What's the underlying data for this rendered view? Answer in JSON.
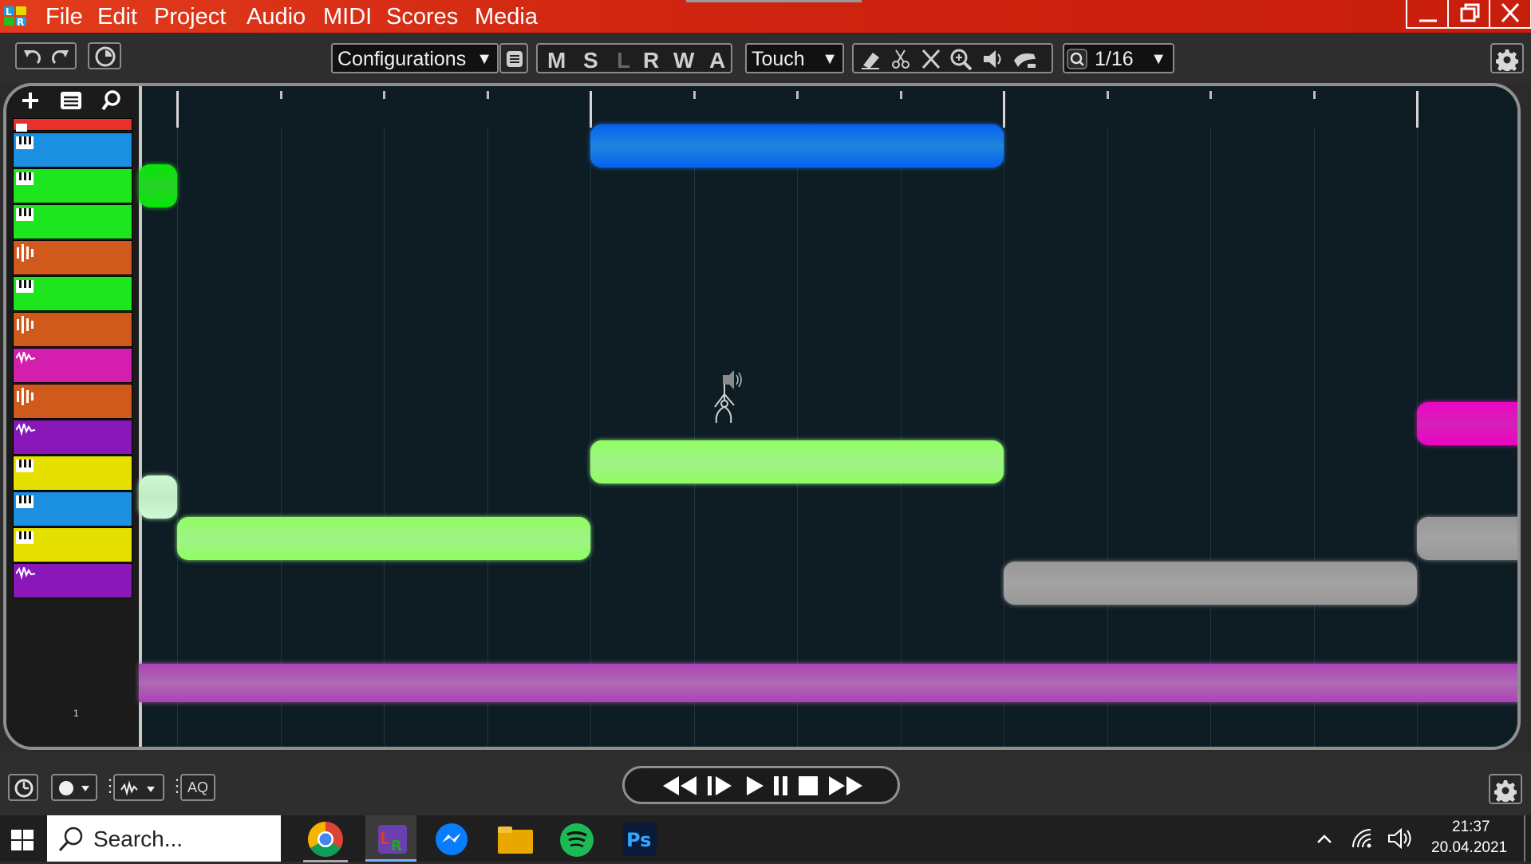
{
  "titlebar": {
    "menu": [
      "File",
      "Edit",
      "Project",
      "Audio",
      "MIDI",
      "Scores",
      "Media"
    ],
    "app_icon": "app-logo-icon",
    "color": "#d42812"
  },
  "toolbar": {
    "configurations_label": "Configurations",
    "mode_letters": [
      "M",
      "S",
      "L",
      "R",
      "W",
      "A"
    ],
    "automation_mode": "Touch",
    "quantize_value": "1/16"
  },
  "track_list": {
    "footer_number": "1",
    "tracks": [
      {
        "type": "folder",
        "color": "#e8312a"
      },
      {
        "type": "midi",
        "color": "#1b8fe0"
      },
      {
        "type": "midi",
        "color": "#1ee61e"
      },
      {
        "type": "midi",
        "color": "#1ee61e"
      },
      {
        "type": "audio",
        "color": "#cf5a1c"
      },
      {
        "type": "midi",
        "color": "#1ee61e"
      },
      {
        "type": "audio",
        "color": "#cf5a1c"
      },
      {
        "type": "wave",
        "color": "#d41fae"
      },
      {
        "type": "audio",
        "color": "#cf5a1c"
      },
      {
        "type": "wave",
        "color": "#8a18b8"
      },
      {
        "type": "midi",
        "color": "#e6e000"
      },
      {
        "type": "midi",
        "color": "#1b8fe0"
      },
      {
        "type": "midi",
        "color": "#e6e000"
      },
      {
        "type": "wave",
        "color": "#8a18b8"
      }
    ]
  },
  "clips": [
    {
      "track": 1,
      "color": "#1a6fd6"
    },
    {
      "track": 2,
      "color": "#20c620"
    },
    {
      "track": 8,
      "color": "#cc1aa8"
    },
    {
      "track": 7,
      "color": "#88f070"
    },
    {
      "track": 9,
      "color": "#b0e6b4"
    },
    {
      "track": 10,
      "color": "#88f070"
    },
    {
      "track": 10,
      "color": "#8c8c8c"
    },
    {
      "track": 11,
      "color": "#8c8c8c"
    },
    {
      "track": 13,
      "color": "#9a5aa0"
    }
  ],
  "bottombar": {
    "aq_label": "AQ"
  },
  "taskbar": {
    "search_placeholder": "Search...",
    "time": "21:37",
    "date": "20.04.2021",
    "apps": [
      "chrome-icon",
      "daw-icon",
      "messenger-icon",
      "file-explorer-icon",
      "spotify-icon",
      "photoshop-icon"
    ]
  }
}
